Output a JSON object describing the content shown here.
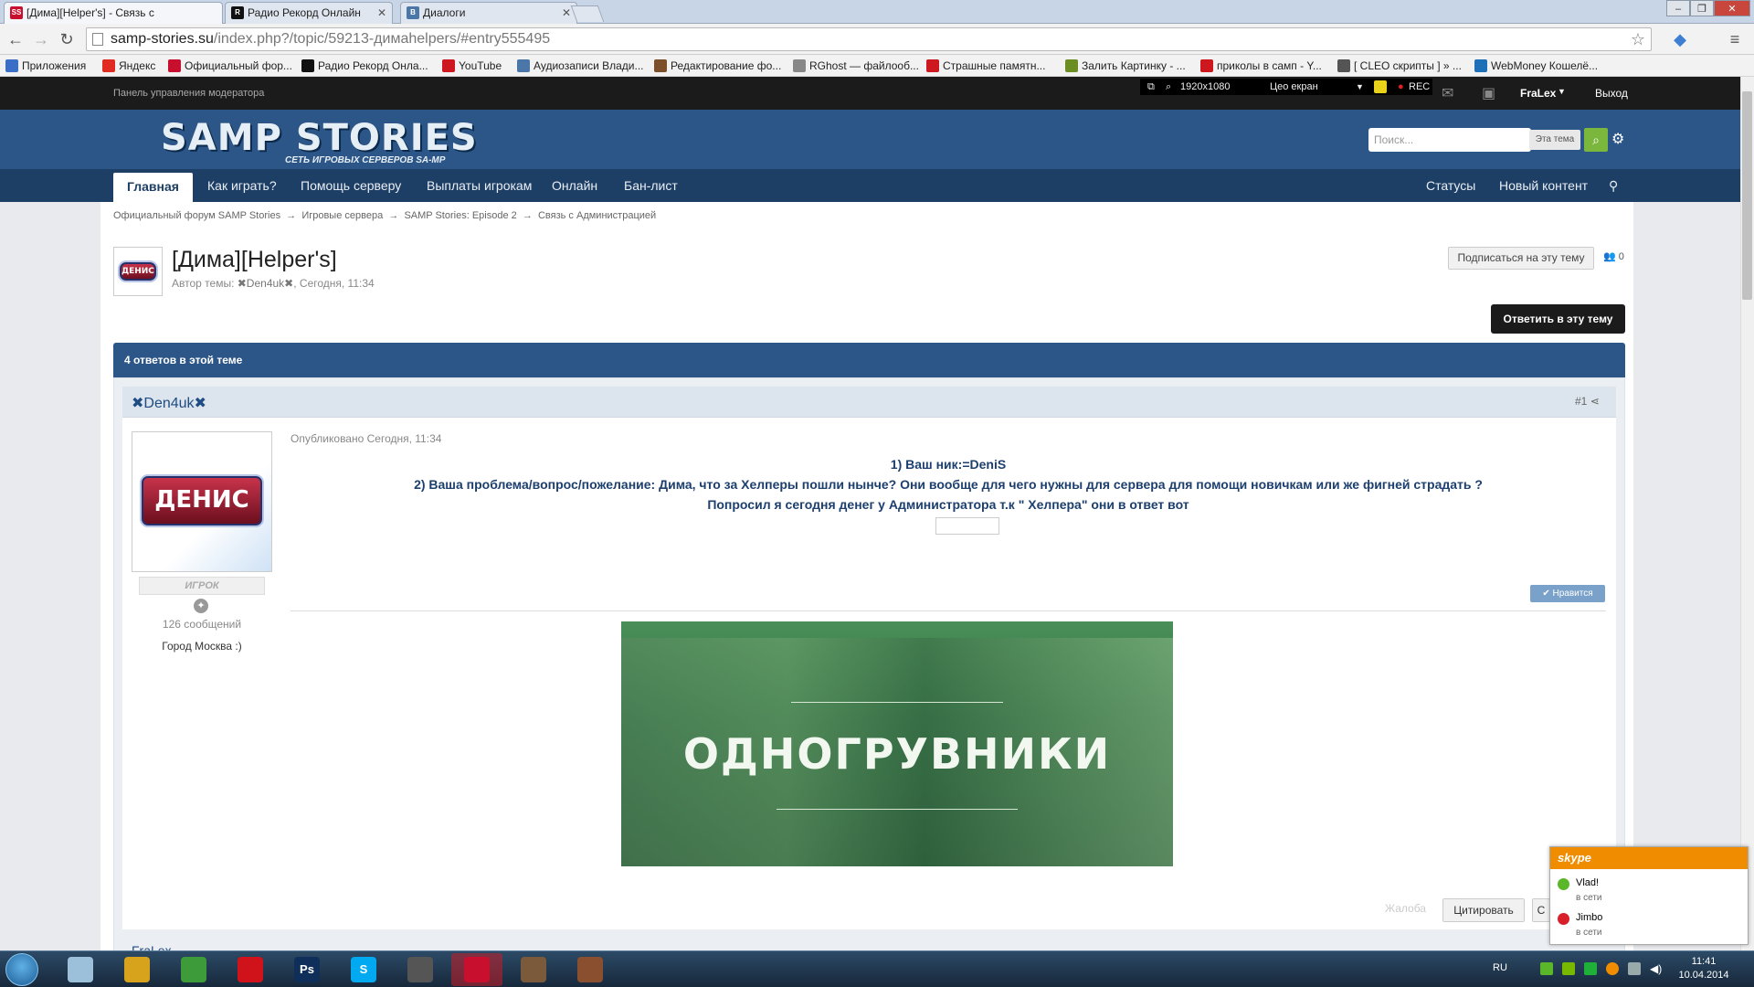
{
  "browser": {
    "tabs": [
      {
        "label": "[Дима][Helper's] - Связь с",
        "favicon": "samp-icon",
        "active": true
      },
      {
        "label": "Радио Рекорд Онлайн",
        "favicon": "radio-icon",
        "active": false
      },
      {
        "label": "Диалоги",
        "favicon": "vk-icon",
        "active": false
      }
    ],
    "url_host": "samp-stories.su",
    "url_path": "/index.php?/topic/59213-димаhelpers/#entry555495",
    "bookmarks": [
      {
        "label": "Приложения",
        "icon": "apps-icon",
        "color": "#3b6fc7"
      },
      {
        "label": "Яндекс",
        "icon": "yandex-icon",
        "color": "#e02b20"
      },
      {
        "label": "Официальный фор...",
        "icon": "samp-icon",
        "color": "#c8102e"
      },
      {
        "label": "Радио Рекорд Онла...",
        "icon": "radio-icon",
        "color": "#111111"
      },
      {
        "label": "YouTube",
        "icon": "youtube-icon",
        "color": "#cc181e"
      },
      {
        "label": "Аудиозаписи Влади...",
        "icon": "vk-icon",
        "color": "#4a76a8"
      },
      {
        "label": "Редактирование фо...",
        "icon": "edit-icon",
        "color": "#7a4f2a"
      },
      {
        "label": "RGhost — файлооб...",
        "icon": "page-icon",
        "color": "#888888"
      },
      {
        "label": "Страшные памятн...",
        "icon": "youtube-icon",
        "color": "#cc181e"
      },
      {
        "label": "Залить Картинку - ...",
        "icon": "image-icon",
        "color": "#6b8e23"
      },
      {
        "label": "приколы в самп - Y...",
        "icon": "youtube-icon",
        "color": "#cc181e"
      },
      {
        "label": "[ CLEO скрипты ] » ...",
        "icon": "cleo-icon",
        "color": "#555555"
      },
      {
        "label": "WebMoney Кошелё...",
        "icon": "webmoney-icon",
        "color": "#1d6fb8"
      }
    ]
  },
  "recorder": {
    "resolution": "1920x1080",
    "mode": "Цео екран",
    "rec": "REC"
  },
  "modbar": {
    "label": "Панель управления модератора",
    "user": "FraLex",
    "logout": "Выход"
  },
  "site": {
    "logo": "SAMP STORIES",
    "logo_sub": "СЕТЬ ИГРОВЫХ СЕРВЕРОВ SA-MP",
    "search_placeholder": "Поиск...",
    "search_scope": "Эта тема",
    "nav": [
      "Главная",
      "Как играть?",
      "Помощь серверу",
      "Выплаты игрокам",
      "Онлайн",
      "Бан-лист"
    ],
    "nav_right": [
      "Статусы",
      "Новый контент"
    ]
  },
  "breadcrumb": [
    "Официальный форум SAMP Stories",
    "Игровые сервера",
    "SAMP Stories: Episode 2",
    "Связь с Администрацией"
  ],
  "topic": {
    "title": "[Дима][Helper's]",
    "meta_prefix": "Автор темы: ",
    "author": "✖Den4uk✖",
    "meta_suffix": ", Сегодня, 11:34",
    "subscribe": "Подписаться на эту тему",
    "followers": "0",
    "reply": "Ответить в эту тему",
    "count": "4 ответов в этой теме"
  },
  "post": {
    "author": "✖Den4uk✖",
    "num": "#1",
    "avatar_text": "ДЕНИС",
    "rank": "ИГРОК",
    "post_count": "126 сообщений",
    "city_label": "Город",
    "city_value": "Москва :)",
    "published": "Опубликовано Сегодня, 11:34",
    "line1": "1) Ваш ник:=DeniS",
    "line2": "2) Ваша проблема/вопрос/пожелание: Дима, что за Хелперы пошли нынче? Они вообще для чего нужны для сервера для помощи новичкам или же фигней страдать ?",
    "line3": "Попросил я сегодня денег у Администратора  т.к \" Хелпера\" они в ответ вот",
    "like": "Нравится",
    "banner_text": "ОДНОГРУВНИКИ",
    "report": "Жалоба",
    "quote": "Цитировать",
    "quote2": "С"
  },
  "next_post_author": "FraLex",
  "skype": {
    "title": "skype",
    "contacts": [
      {
        "name": "Vlad!",
        "status": "в сети",
        "color": "#5bb72a"
      },
      {
        "name": "Jimbo",
        "status": "в сети",
        "color": "#d9202a"
      }
    ]
  },
  "taskbar": {
    "lang": "RU",
    "time": "11:41",
    "date": "10.04.2014",
    "apps": [
      {
        "icon": "pencil-icon",
        "label": "",
        "color": "#9cc0da"
      },
      {
        "icon": "chrome-icon",
        "label": "",
        "color": "#d8a31c"
      },
      {
        "icon": "green-app-icon",
        "label": "",
        "color": "#3e9b3a"
      },
      {
        "icon": "record-icon",
        "label": "",
        "color": "#d0121a"
      },
      {
        "icon": "photoshop-icon",
        "label": "Ps",
        "color": "#0f2f5a"
      },
      {
        "icon": "skype-icon",
        "label": "S",
        "color": "#00a9f0"
      },
      {
        "icon": "wot-icon",
        "label": "",
        "color": "#555555"
      },
      {
        "icon": "game-icon",
        "label": "",
        "color": "#c8102e"
      },
      {
        "icon": "samp-player-icon",
        "label": "",
        "color": "#7a5a3a"
      },
      {
        "icon": "samp-player2-icon",
        "label": "",
        "color": "#8a4f2f"
      }
    ]
  }
}
